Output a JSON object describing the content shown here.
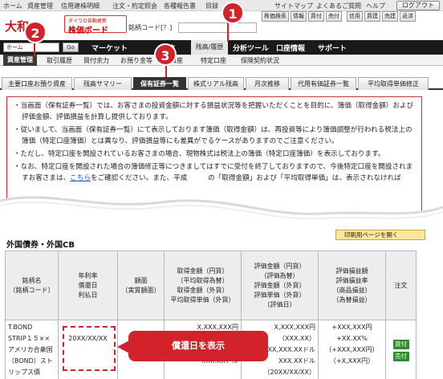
{
  "topbar": {
    "links": [
      "ホーム",
      "資産管理",
      "信用建株明細",
      "注文・約定照会",
      "各種報告書",
      "目録"
    ],
    "site_map": "サイトマップ",
    "faq": "よくあるご質問",
    "help": "ヘルプ",
    "logout": "ログアウト"
  },
  "header": {
    "logo": "大和",
    "promo_small": "ダイワの自動更新",
    "promo_big": "株価ボード",
    "code_label": "銘柄コード[？]",
    "buttons": [
      "株価検索",
      "情報",
      "買付",
      "売付",
      "信用",
      "買建",
      "売建",
      "返済"
    ]
  },
  "navbar": {
    "select_value": "ホーム",
    "go_label": "Go",
    "items": [
      "マーケット",
      "投信",
      "残高/履歴",
      "分析ツール",
      "口座情報",
      "サポート"
    ]
  },
  "subnav": {
    "items": [
      "資産管理",
      "取引履歴",
      "買付余力",
      "お預り金等",
      "口座",
      "特定口座",
      "保険契約状況"
    ]
  },
  "tabs": [
    "主要口座お預り資産",
    "残高サマリー",
    "保有証券一覧",
    "株式リアル残高",
    "月次推移",
    "代用有価証券一覧",
    "平均取得単価修正"
  ],
  "notice": {
    "p1": "・当画面（保有証券一覧）では、お客さまの投資金額に対する損益状況等を把握いただくことを目的に、簿価（取得金額）および評価金額、評価損益を計算し提供しております。",
    "p2": "・従いまして、当画面（保有証券一覧）にて表示しております簿価（取得金額）は、再投資等により簿価調整が行われる税法上の簿価（特定口座簿価）とは異なり、評価損益等にも差異がでるケースがありますのでご注意ください。",
    "p3": "・ただし、特定口座を開設されているお客さまの場合、現物株式は税法上の簿価（特定口座簿価）を表示しております。",
    "p4a": "・なお、特定口座を開設された場合の簿価修正等につきましてはすでに受付を終了しておりますので、今後特定口座を開設されますお客さまは、",
    "p4link": "こちら",
    "p4b": "をご確認ください。また、平成　　　の「取得金額」および「平均取得単価」は、表示されなければ"
  },
  "print_button": "印刷用ページを開く",
  "section_title": "外国債券・外国CB",
  "table": {
    "headers": {
      "name": "銘柄名\n（銘柄コード）",
      "rate": "年利率\n償還日\n利払日",
      "face": "額面\n（実質額面）",
      "cost": "取得金額（円貨）\n（平均取得為替）\n取得金額（外貨）\n平均取得単価（外貨）",
      "eval": "評価金額（円貨）\n（評価為替）\n評価金額（外貨）\n評価単価（外貨）\n（評価日）",
      "pl": "評価損益額\n評価損益率\n（商品損益）\n（為替損益）",
      "order": "注文"
    },
    "row": {
      "name": "T.BOND\nSTRIP１５××\nアメリカ合衆国\n（BOND）スト\nリップス債",
      "rate": "-",
      "maturity": "20XX/XX/XX",
      "pay": "-",
      "face": "",
      "cost": "X,XXX,XXX円\n（XXX.XX）\nXX,XXX.XXドル\nXXX.XXドル",
      "eval": "X,XXX,XXX円\n（XXX.XX）\nXX,XXX.XXドル\nXXX.XXドル\n（20XX/XX/XX）",
      "pl": "+XXX,XXX円\n+XX.XX%\n（+XXX,XXX円）\n（+X,XXX円）",
      "buy": "買付",
      "sell": "売付"
    }
  },
  "callout": "償還日を表示",
  "badges": [
    "1",
    "2",
    "3"
  ],
  "colors": {
    "accent_red": "#d2232a",
    "order_green": "#2e8b2e"
  }
}
